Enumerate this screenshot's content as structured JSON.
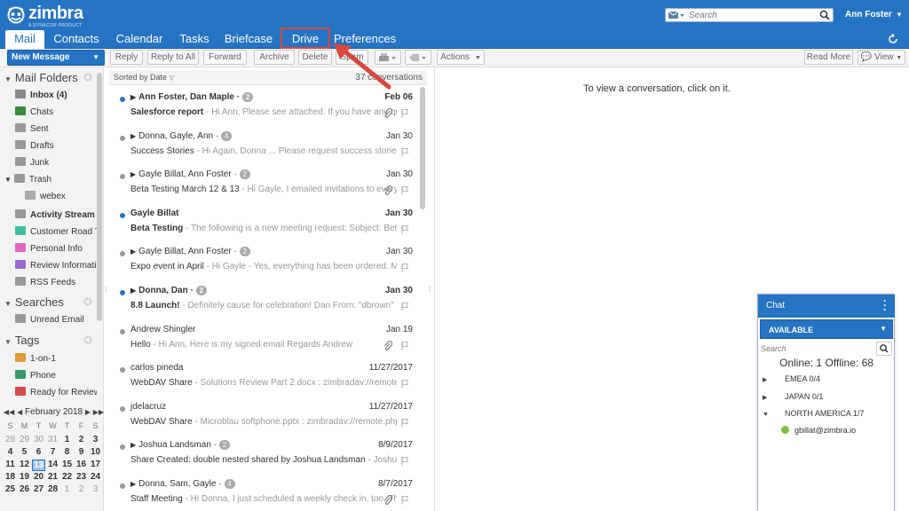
{
  "header": {
    "logo_text": "zimbra",
    "logo_sub": "A SYNACOR PRODUCT",
    "search_placeholder": "Search",
    "user_name": "Ann Foster",
    "tabs": [
      {
        "label": "Mail",
        "active": true
      },
      {
        "label": "Contacts"
      },
      {
        "label": "Calendar"
      },
      {
        "label": "Tasks"
      },
      {
        "label": "Briefcase"
      },
      {
        "label": "Drive",
        "highlighted": true
      },
      {
        "label": "Preferences"
      }
    ]
  },
  "toolbar": {
    "new_message": "New Message",
    "reply": "Reply",
    "reply_all": "Reply to All",
    "forward": "Forward",
    "archive": "Archive",
    "delete": "Delete",
    "spam": "Spam",
    "actions": "Actions",
    "read_more": "Read More",
    "view": "View"
  },
  "sidebar": {
    "mail_folders_title": "Mail Folders",
    "folders": [
      {
        "label": "Inbox (4)",
        "bold": true,
        "color": "#555555"
      },
      {
        "label": "Chats",
        "color": "#3a8a3a"
      },
      {
        "label": "Sent",
        "color": "#777777"
      },
      {
        "label": "Drafts",
        "color": "#777777"
      },
      {
        "label": "Junk",
        "color": "#777777"
      },
      {
        "label": "Trash",
        "color": "#777777"
      },
      {
        "label": "webex",
        "color": "#888888"
      },
      {
        "label": "Activity Stream (",
        "bold": true,
        "color": "#777777"
      },
      {
        "label": "Customer Road T",
        "color": "#3fbf9f"
      },
      {
        "label": "Personal Info",
        "color": "#e066c2"
      },
      {
        "label": "Review Informatic",
        "color": "#9a6ad0"
      },
      {
        "label": "RSS Feeds",
        "color": "#777777"
      }
    ],
    "searches_title": "Searches",
    "searches": [
      {
        "label": "Unread Email"
      }
    ],
    "tags_title": "Tags",
    "tags": [
      {
        "label": "1-on-1",
        "color": "#e09a3a"
      },
      {
        "label": "Phone",
        "color": "#3a9a6a"
      },
      {
        "label": "Ready for Review",
        "color": "#d94a4a"
      }
    ]
  },
  "calendar": {
    "month_label": "February 2018",
    "days_of_week": [
      "S",
      "M",
      "T",
      "W",
      "T",
      "F",
      "S"
    ],
    "weeks": [
      [
        "28",
        "29",
        "30",
        "31",
        "1",
        "2",
        "3"
      ],
      [
        "4",
        "5",
        "6",
        "7",
        "8",
        "9",
        "10"
      ],
      [
        "11",
        "12",
        "13",
        "14",
        "15",
        "16",
        "17"
      ],
      [
        "18",
        "19",
        "20",
        "21",
        "22",
        "23",
        "24"
      ],
      [
        "25",
        "26",
        "27",
        "28",
        "1",
        "2",
        "3"
      ]
    ],
    "today": "13"
  },
  "list": {
    "sort_label": "Sorted by Date",
    "count_label": "37 conversations",
    "conversations": [
      {
        "from": "Ann Foster, Dan Maple",
        "count": "2",
        "date": "Feb 06",
        "subject": "Salesforce report",
        "fragment": " - Hi Ann, Please see attached. If you have any qu",
        "unread": true,
        "thread": true,
        "attach": true
      },
      {
        "from": "Donna, Gayle, Ann",
        "count": "4",
        "date": "Jan 30",
        "subject": "Success Stories",
        "fragment": " - Hi Again, Donna ... Please request success stories in gc",
        "unread": false,
        "thread": true,
        "attach": false
      },
      {
        "from": "Gayle Billat, Ann Foster",
        "count": "2",
        "date": "Jan 30",
        "subject": "Beta Testing March 12 & 13",
        "fragment": " - Hi Gayle, I emailed invitations to every",
        "unread": false,
        "thread": true,
        "attach": true
      },
      {
        "from": "Gayle Billat",
        "count": "",
        "date": "Jan 30",
        "subject": "Beta Testing",
        "fragment": " - The following is a new meeting request: Subject: Beta Te",
        "unread": true,
        "thread": false,
        "attach": false
      },
      {
        "from": "Gayle Billat, Ann Foster",
        "count": "2",
        "date": "Jan 30",
        "subject": "Expo event in April",
        "fragment": " - Hi Gayle - Yes, everything has been ordered. Most i",
        "unread": false,
        "thread": true,
        "attach": false
      },
      {
        "from": "Donna, Dan",
        "count": "2",
        "date": "Jan 30",
        "subject": "8.8 Launch!",
        "fragment": " - Definitely cause for celebration! Dan From: \"dbrown\" <dbr",
        "unread": true,
        "thread": true,
        "attach": false
      },
      {
        "from": "Andrew Shingler",
        "count": "",
        "date": "Jan 19",
        "subject": "Hello",
        "fragment": " - Hi Ann, Here is my signed email Regards Andrew",
        "unread": false,
        "thread": false,
        "attach": true
      },
      {
        "from": "carlos pineda",
        "count": "",
        "date": "11/27/2017",
        "subject": "WebDAV Share",
        "fragment": " - Solutions Review Part 2.docx : zimbradav://remote.php",
        "unread": false,
        "thread": false,
        "attach": false
      },
      {
        "from": "jdelacruz",
        "count": "",
        "date": "11/27/2017",
        "subject": "WebDAV Share",
        "fragment": " - Microblau softphone.pptx : zimbradav://remote.php/w",
        "unread": false,
        "thread": false,
        "attach": false
      },
      {
        "from": "Joshua Landsman",
        "count": "2",
        "date": "8/9/2017",
        "subject": "Share Created: double nested shared by Joshua Landsman",
        "fragment": " - Joshua Land",
        "unread": false,
        "thread": true,
        "attach": false
      },
      {
        "from": "Donna, Sam, Gayle",
        "count": "4",
        "date": "8/7/2017",
        "subject": "Staff Meeting",
        "fragment": " - Hi Donna, I just scheduled a weekly check in, too. Th",
        "unread": false,
        "thread": true,
        "attach": true
      }
    ]
  },
  "reading": {
    "empty_message": "To view a conversation, click on it."
  },
  "chat": {
    "title": "Chat",
    "status": "AVAILABLE",
    "search_placeholder": "Search",
    "online_summary": "Online: 1 Offline: 68",
    "groups": [
      {
        "label": "EMEA 0/4",
        "expanded": false
      },
      {
        "label": "JAPAN 0/1",
        "expanded": false
      },
      {
        "label": "NORTH AMERICA 1/7",
        "expanded": true
      }
    ],
    "buddy": "gbillat@zimbra.io"
  },
  "colors": {
    "brand_blue": "#2574c4",
    "callout_red": "#d9473e",
    "unread_dot": "#2574c4",
    "online_green": "#7cc241"
  }
}
